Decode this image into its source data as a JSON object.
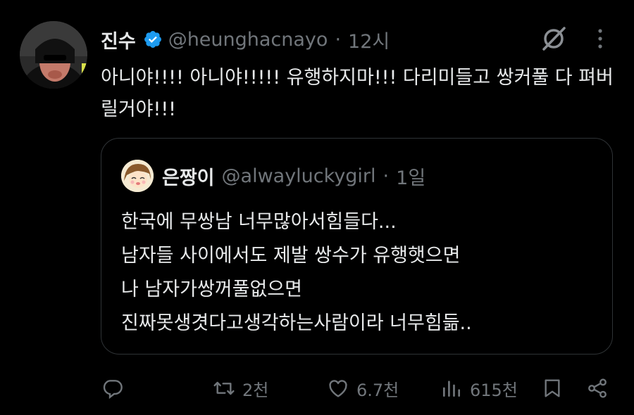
{
  "tweet": {
    "author_name": "진수",
    "author_handle": "@heunghacnayo",
    "separator": "·",
    "time": "12시",
    "text": "아니야!!!! 아니야!!!!! 유행하지마!!! 다리미들고 쌍커풀 다 펴버릴거야!!!"
  },
  "quote": {
    "author_name": "은짱이",
    "author_handle": "@alwayluckygirl",
    "separator": "·",
    "time": "1일",
    "text": "한국에 무쌍남 너무많아서힘들다...\n남자들 사이에서도 제발 쌍수가 유행햇으면\n나 남자가쌍꺼풀없으면\n진짜못생겻다고생각하는사람이라 너무힘듦.."
  },
  "actions": {
    "reply": "",
    "retweet": "2천",
    "like": "6.7천",
    "views": "615천"
  },
  "icons": [
    "verified-badge-icon",
    "grok-icon",
    "more-icon",
    "reply-icon",
    "retweet-icon",
    "like-icon",
    "views-icon",
    "bookmark-icon",
    "share-icon"
  ],
  "colors": {
    "background": "#000000",
    "text": "#e7e9ea",
    "muted": "#71767b",
    "verified": "#1d9bf0",
    "border": "#2f3336"
  }
}
